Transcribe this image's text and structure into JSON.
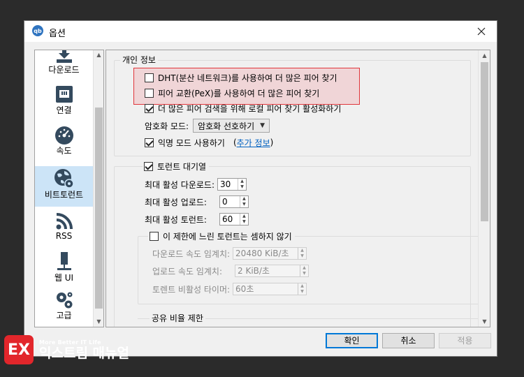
{
  "window": {
    "title": "옵션",
    "app_icon_text": "qb"
  },
  "sidebar": {
    "items": [
      {
        "label": "다운로드",
        "icon": "download-icon"
      },
      {
        "label": "연결",
        "icon": "network-icon"
      },
      {
        "label": "속도",
        "icon": "speedometer-icon"
      },
      {
        "label": "비트토런트",
        "icon": "globe-gear-icon",
        "selected": true
      },
      {
        "label": "RSS",
        "icon": "rss-icon"
      },
      {
        "label": "웹 UI",
        "icon": "screen-icon"
      },
      {
        "label": "고급",
        "icon": "gears-icon"
      }
    ]
  },
  "privacy": {
    "title": "개인 정보",
    "dht": "DHT(분산 네트워크)를 사용하여 더 많은 피어 찾기",
    "pex": "피어 교환(PeX)를 사용하여 더 많은 피어 찾기",
    "lsd": "더 많은 피어 검색을 위해 로컬 피어 찾기 활성화하기",
    "encryption_label": "암호화 모드:",
    "encryption_value": "암호화 선호하기",
    "anon_label": "익명 모드 사용하기",
    "anon_link_open": "(",
    "anon_link": "추가 정보",
    "anon_link_close": ")"
  },
  "queue": {
    "title": "토런트 대기열",
    "max_downloads_label": "최대 활성 다운로드:",
    "max_downloads": "30",
    "max_uploads_label": "최대 활성 업로드:",
    "max_uploads": "0",
    "max_torrents_label": "최대 활성 토런트:",
    "max_torrents": "60",
    "slow_label": "이 제한에 느린 토런트는 셈하지 않기",
    "dl_threshold_label": "다운로드 속도 임계치:",
    "dl_threshold": "20480 KiB/초",
    "ul_threshold_label": "업로드 속도 임계치:",
    "ul_threshold": "2 KiB/초",
    "inactive_timer_label": "토렌트 비활성 타이머:",
    "inactive_timer": "60초"
  },
  "share": {
    "title": "공유 비율 제한"
  },
  "buttons": {
    "ok": "확인",
    "cancel": "취소",
    "apply": "적용"
  },
  "watermark": {
    "small": "More Better IT Life",
    "big": "익스트림 매뉴얼"
  },
  "colors": {
    "highlight_border": "#e0353b",
    "selection": "#cce4f7",
    "accent": "#0078d7",
    "watermark_red": "#e2262b"
  }
}
